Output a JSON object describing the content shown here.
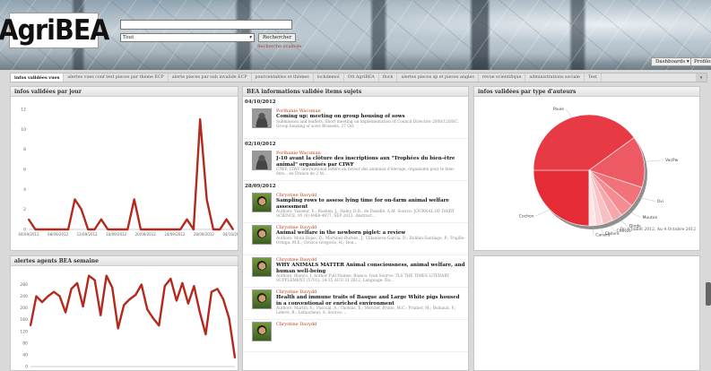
{
  "header": {
    "logo": "AgriBEA",
    "search_placeholder": "",
    "type_selected": "Tout",
    "search_button": "Rechercher",
    "advanced_link": "Recherche avancée",
    "dashboards_button": "Dashboards ▾",
    "profile_button": "Profiles"
  },
  "tabs": [
    "infos validées vues",
    "alertes vues conf test pieces par thème ECP",
    "alerte pieces par sub invalide ECP",
    "pourcentables et thèmes",
    "lockdemol",
    "Ott AgriBEA",
    "flock",
    "alertes pieces sp et pieces angles",
    "revue scientifique",
    "administrations sociale",
    "Test"
  ],
  "panels": {
    "infos_jour": "infos validées par jour",
    "alertes_semaine": "alertes agents BEA semaine",
    "infos_recents": "BEA informations validée items sujets",
    "infos_type": "infos validées par type d'auteurs"
  },
  "feed": [
    {
      "date": "04/10/2012",
      "items": [
        {
          "author": "Porlhanie Wacsman",
          "title": "Coming up: meeting on group housing of sows",
          "snippet": "Submission and leaflets. Short meeting on implementation of Council Directive 2008/120/EC. Group housing of sows Brussels, 27 Oct",
          "thumb": "gray"
        }
      ]
    },
    {
      "date": "02/10/2012",
      "items": [
        {
          "author": "Porlhanie Wacsman",
          "title": "J-10 avant la clôture des inscriptions aux \"Trophées du bien-être animal\" organisés par CIWF",
          "snippet": "CIWF, CIWF international fédère en faveur des animaux d'élevage, organisme pour le bien-être... en France de 2 M...",
          "thumb": "gray"
        }
      ]
    },
    {
      "date": "28/09/2012",
      "items": [
        {
          "author": "Chrystine Davydd",
          "title": "Sampling rows to assess lying time for on-farm animal welfare assessment",
          "snippet": "Authors: Vasseur, E.; Rushen, J.; Haley, D.B.; de Passillé, A.M. Source: JOURNAL OF DAIRY SCIENCE, 95 (9) 4968-4977, SEP 2012. Abstract...",
          "thumb": "green"
        },
        {
          "author": "Chrystine Davydd",
          "title": "Animal welfare in the newborn piglet: a review",
          "snippet": "Authors: Mota-Rojas, D.; Martinez-Burnes, J.; Villanueva-Garcia, D.; Roldan-Santiago, P.; Trujillo-Ortega, M.E.; Orozco-Gregorio, H.; Bon...",
          "thumb": "green"
        },
        {
          "author": "Chrystine Davydd",
          "title": "WHY ANIMALS MATTER Animal consciousness, animal welfare, and human well-being",
          "snippet": "Authors: Bianco, I. Author Full Names: Bianco, Ivan Source: TLS THE TIMES LITERARY SUPPLEMENT (5701): 24-35 AUG 31 2012. Language: En...",
          "thumb": "green"
        },
        {
          "author": "Chrystine Davydd",
          "title": "Health and immune traits of Basque and Large White pigs housed in a conventional or enriched environment",
          "snippet": "Authors: Martin, E.; Pascual, A.; Thomas, E.; Mercier, Bruno, M.C.; Prunier, M.; Bolnaud, F.; Lebret, B.; Lefaucheur, A. Source: ...",
          "thumb": "green"
        },
        {
          "author": "Chrystine Davydd",
          "title": "",
          "snippet": "",
          "thumb": "green"
        }
      ]
    }
  ],
  "pie_note": "Du 4 Juillet 2012, Au 4 Octobre 2012",
  "chart_data": [
    {
      "type": "line",
      "title": "infos validées par jour",
      "x": [
        "04/09/2012",
        "",
        "",
        "",
        "",
        "",
        "",
        "",
        "",
        "",
        "",
        "",
        "",
        "",
        "",
        "",
        "",
        "",
        "",
        "",
        "",
        "",
        "",
        "",
        "",
        "",
        "",
        "",
        "",
        "",
        "",
        "04/10/2012"
      ],
      "xticks": [
        "04/09/2012",
        "08/09/2012",
        "12/09/2012",
        "16/09/2012",
        "20/09/2012",
        "24/09/2012",
        "28/09/2012",
        "04/10/2012"
      ],
      "values": [
        1,
        0,
        0,
        0,
        0,
        0,
        0,
        3,
        2,
        0,
        0,
        1,
        0,
        0,
        0,
        0,
        3,
        0,
        0,
        0,
        0,
        0,
        0,
        0,
        1,
        0,
        11,
        3,
        0,
        0,
        1,
        0
      ],
      "ylim": [
        0,
        12
      ],
      "yticks": [
        0,
        2,
        4,
        6,
        8,
        10,
        12
      ],
      "color": "#b5291d",
      "grid": false
    },
    {
      "type": "line",
      "title": "alertes agents BEA semaine",
      "values": [
        140,
        240,
        220,
        240,
        255,
        240,
        185,
        265,
        285,
        205,
        310,
        295,
        175,
        310,
        270,
        130,
        210,
        230,
        245,
        280,
        195,
        165,
        140,
        275,
        300,
        225,
        285,
        215,
        275,
        185,
        110,
        255,
        265,
        230,
        165,
        30
      ],
      "ylim": [
        0,
        300
      ],
      "yticks": [
        0,
        40,
        80,
        120,
        160,
        200,
        240,
        280
      ],
      "color": "#b5291d",
      "grid": false
    },
    {
      "type": "pie",
      "title": "infos validées par type d'auteurs",
      "labels": [
        "Cochon",
        "Poule",
        "VacPw",
        "Ovi",
        "Mouton",
        "Dinde",
        "Cheval",
        "Chèvre",
        "Canard"
      ],
      "values": [
        25,
        40,
        15,
        6,
        4,
        3,
        3,
        2,
        2
      ],
      "colors": [
        "#e42b36",
        "#e83a45",
        "#ee5a63",
        "#f2727a",
        "#f58c92",
        "#f7a6ab",
        "#f9c0c3",
        "#fbd5d7",
        "#fde6e7"
      ]
    }
  ]
}
